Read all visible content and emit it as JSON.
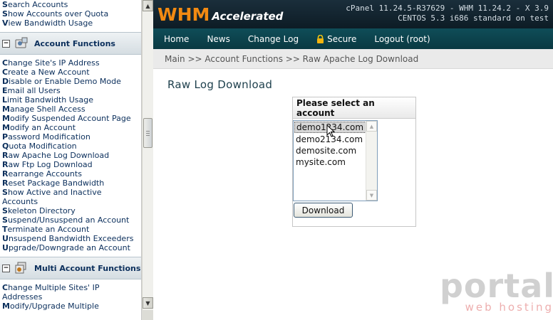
{
  "sidebar": {
    "top_links": [
      {
        "first": "S",
        "rest": "earch Accounts"
      },
      {
        "first": "S",
        "rest": "how Accounts over Quota"
      },
      {
        "first": "V",
        "rest": "iew Bandwidth Usage"
      }
    ],
    "section1_title": "Account Functions",
    "section1_links": [
      {
        "first": "C",
        "rest": "hange Site's IP Address"
      },
      {
        "first": "C",
        "rest": "reate a New Account"
      },
      {
        "first": "D",
        "rest": "isable or Enable Demo Mode"
      },
      {
        "first": "E",
        "rest": "mail all Users"
      },
      {
        "first": "L",
        "rest": "imit Bandwidth Usage"
      },
      {
        "first": "M",
        "rest": "anage Shell Access"
      },
      {
        "first": "M",
        "rest": "odify Suspended Account Page"
      },
      {
        "first": "M",
        "rest": "odify an Account"
      },
      {
        "first": "P",
        "rest": "assword Modification"
      },
      {
        "first": "Q",
        "rest": "uota Modification"
      },
      {
        "first": "R",
        "rest": "aw Apache Log Download"
      },
      {
        "first": "R",
        "rest": "aw Ftp Log Download"
      },
      {
        "first": "R",
        "rest": "earrange Accounts"
      },
      {
        "first": "R",
        "rest": "eset Package Bandwidth"
      },
      {
        "first": "S",
        "rest": "how Active and Inactive Accounts"
      },
      {
        "first": "S",
        "rest": "keleton Directory"
      },
      {
        "first": "S",
        "rest": "uspend/Unsuspend an Account"
      },
      {
        "first": "T",
        "rest": "erminate an Account"
      },
      {
        "first": "U",
        "rest": "nsuspend Bandwidth Exceeders"
      },
      {
        "first": "U",
        "rest": "pgrade/Downgrade an Account"
      }
    ],
    "section2_title": "Multi Account Functions",
    "section2_links": [
      {
        "first": "C",
        "rest": "hange Multiple Sites' IP Addresses"
      },
      {
        "first": "M",
        "rest": "odify/Upgrade Multiple"
      }
    ]
  },
  "header": {
    "logo_main": "WHM",
    "logo_sub": "Accelerated",
    "version_line1": "cPanel 11.24.5-R37629 - WHM 11.24.2 - X 3.9",
    "version_line2": "CENTOS 5.3 i686 standard on test"
  },
  "nav": {
    "home": "Home",
    "news": "News",
    "change_log": "Change Log",
    "secure": "Secure",
    "logout": "Logout (root)"
  },
  "breadcrumb": "Main >> Account Functions >> Raw Apache Log Download",
  "page_title": "Raw Log Download",
  "form": {
    "heading": "Please select an account",
    "accounts": [
      "demo1234.com",
      "demo2134.com",
      "demosite.com",
      "mysite.com"
    ],
    "selected": "demo1234.com",
    "button_label": "Download"
  },
  "watermark": {
    "brand": "portal",
    "sub": "web hosting"
  },
  "colors": {
    "logo_orange": "#f28a12",
    "nav_teal": "#0f4d58",
    "topbar_dark": "#1a2e3b",
    "link_blue": "#0b2f5c"
  }
}
